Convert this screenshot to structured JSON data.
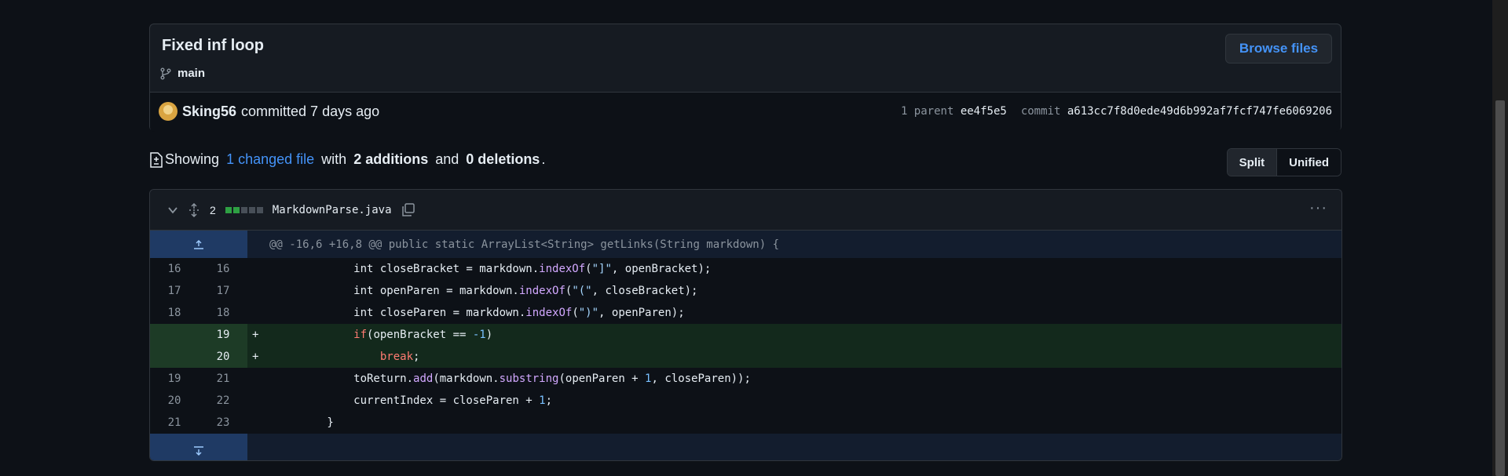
{
  "commit": {
    "title": "Fixed inf loop",
    "branch": "main",
    "browse_label": "Browse files",
    "author": "Sking56",
    "action": "committed 7 days ago",
    "parent_label": "1 parent",
    "parent_sha": "ee4f5e5",
    "commit_label": "commit",
    "commit_sha": "a613cc7f8d0ede49d6b992af7fcf747fe6069206"
  },
  "summary": {
    "showing": "Showing",
    "changed": "1 changed file",
    "with": "with",
    "additions": "2 additions",
    "and": "and",
    "deletions": "0 deletions",
    "period": "."
  },
  "view_toggle": {
    "split": "Split",
    "unified": "Unified"
  },
  "file": {
    "change_count": "2",
    "name": "MarkdownParse.java",
    "hunk_header": "@@ -16,6 +16,8 @@ public static ArrayList<String> getLinks(String markdown) {",
    "lines": [
      {
        "old": "16",
        "new": "16",
        "sign": ""
      },
      {
        "old": "17",
        "new": "17",
        "sign": ""
      },
      {
        "old": "18",
        "new": "18",
        "sign": ""
      },
      {
        "old": "",
        "new": "19",
        "sign": "+"
      },
      {
        "old": "",
        "new": "20",
        "sign": "+"
      },
      {
        "old": "19",
        "new": "21",
        "sign": ""
      },
      {
        "old": "20",
        "new": "22",
        "sign": ""
      },
      {
        "old": "21",
        "new": "23",
        "sign": ""
      }
    ]
  },
  "colors": {
    "addition": "#2ea043",
    "link": "#4493f8",
    "keyword": "#ff7b72",
    "function": "#d2a8ff"
  }
}
